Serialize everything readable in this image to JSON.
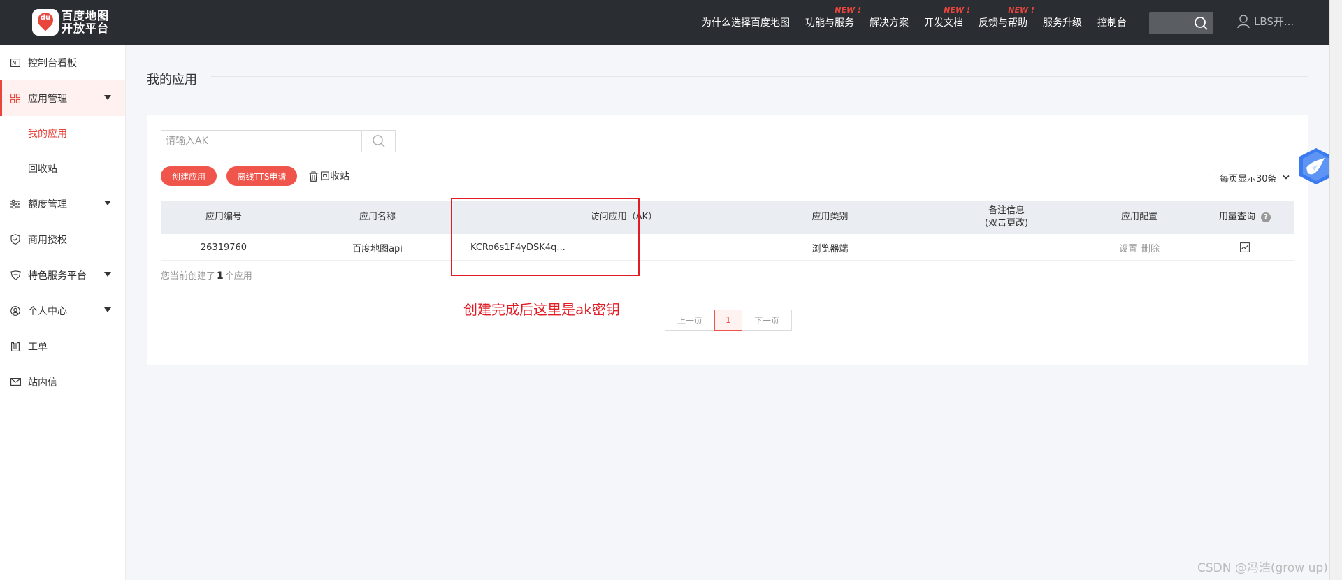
{
  "brand": {
    "logo_text_line1": "百度地图",
    "logo_text_line2": "开放平台",
    "logo_badge": "du",
    "accent": "#e8453c"
  },
  "nav": {
    "items": [
      {
        "label": "为什么选择百度地图",
        "new": ""
      },
      {
        "label": "功能与服务",
        "new": "NEW !"
      },
      {
        "label": "解决方案",
        "new": ""
      },
      {
        "label": "开发文档",
        "new": "NEW !"
      },
      {
        "label": "反馈与帮助",
        "new": "NEW !"
      },
      {
        "label": "服务升级",
        "new": ""
      },
      {
        "label": "控制台",
        "new": ""
      }
    ],
    "user": "LBS开..."
  },
  "sidebar": {
    "items": [
      {
        "label": "控制台看板",
        "icon": "dashboard-icon"
      },
      {
        "label": "应用管理",
        "icon": "grid-icon"
      },
      {
        "label": "我的应用"
      },
      {
        "label": "回收站"
      },
      {
        "label": "额度管理",
        "icon": "sliders-icon"
      },
      {
        "label": "商用授权",
        "icon": "shield-icon"
      },
      {
        "label": "特色服务平台",
        "icon": "badge-icon"
      },
      {
        "label": "个人中心",
        "icon": "user-icon"
      },
      {
        "label": "工单",
        "icon": "clipboard-icon"
      },
      {
        "label": "站内信",
        "icon": "mail-icon"
      }
    ]
  },
  "main": {
    "title": "我的应用",
    "search_placeholder": "请输入AK",
    "btn_create": "创建应用",
    "btn_tts": "离线TTS申请",
    "btn_recycle": "回收站",
    "page_size": "每页显示30条",
    "table": {
      "headers": [
        "应用编号",
        "应用名称",
        "访问应用（AK）",
        "应用类别",
        "备注信息",
        "(双击更改)",
        "应用配置",
        "用量查询"
      ],
      "row": {
        "id": "26319760",
        "name": "百度地图api",
        "ak": "KCRo6s1F4yDSK4q...",
        "type": "浏览器端",
        "note": "",
        "config_set": "设置",
        "config_delete": "删除"
      }
    },
    "count_prefix": "您当前创建了",
    "count_value": "1",
    "count_suffix": "个应用",
    "pager": {
      "prev": "上一页",
      "current": "1",
      "next": "下一页"
    },
    "help_glyph": "?"
  },
  "annotation": {
    "text": "创建完成后这里是ak密钥",
    "color": "#e21c24"
  },
  "watermark": "CSDN @冯浩(grow up)"
}
